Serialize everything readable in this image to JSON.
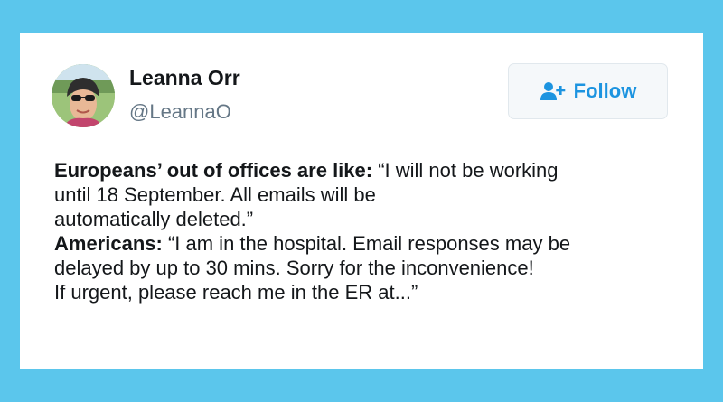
{
  "author": {
    "name": "Leanna Orr",
    "handle": "@LeannaO",
    "avatar_icon": "profile-photo"
  },
  "follow_button": {
    "label": "Follow",
    "icon": "add-user-icon",
    "color": "#1c94e0"
  },
  "tweet": {
    "lines": [
      {
        "bold": "Europeans’ out of offices are like:",
        "text": " “I will not be working"
      },
      {
        "bold": "",
        "text": "until 18 September. All emails will be"
      },
      {
        "bold": "",
        "text": "automatically deleted.”"
      },
      {
        "bold": "Americans:",
        "text": " “I am in the hospital. Email responses may be"
      },
      {
        "bold": "",
        "text": "delayed by up to 30 mins. Sorry for the inconvenience!"
      },
      {
        "bold": "",
        "text": "If urgent, please reach me in the ER at...”"
      }
    ]
  },
  "colors": {
    "background": "#5bc6ec",
    "card": "#ffffff",
    "text": "#14171a",
    "handle": "#657786"
  }
}
